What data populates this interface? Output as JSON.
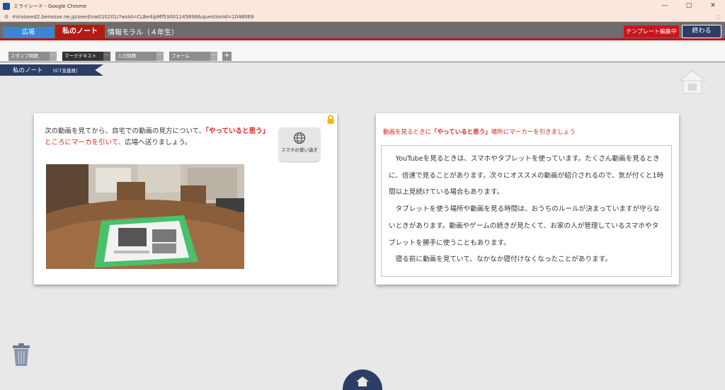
{
  "browser": {
    "window_title": "ミライシード - Google Chrome",
    "url": "miraiseed2.benesse.ne.jp/seed/vw010201/?wsId=CLBe4ipMf53001145698&questionId=1048069",
    "controls": [
      "—",
      "▢",
      "✕"
    ]
  },
  "header": {
    "tab_hiroba": "広場",
    "tab_mynote": "私のノート",
    "title": "情報モラル（４年生）",
    "template_button": "テンプレート編集中",
    "end_button": "終わる"
  },
  "toolbar": {
    "tabs": [
      {
        "label": "スタンプ問題",
        "more": "···"
      },
      {
        "label": "マークテキスト",
        "more": "···"
      },
      {
        "label": "入力問題",
        "more": "···"
      },
      {
        "label": "フォーム",
        "more": "···"
      }
    ],
    "add_label": "+"
  },
  "breadcrumb": {
    "title": "私のノート",
    "sub": "（ICT支援員）"
  },
  "left_card": {
    "instruction_1": "次の動画を見てから、自宅での動画の見方について、",
    "instruction_2": "「やっていると思う」",
    "instruction_3": "ところにマーカを引いて、",
    "instruction_4": "広場へ送りましょう。",
    "link_label": "スマホの使い過ぎ"
  },
  "right_card": {
    "heading_1": "動画を見るときに",
    "heading_2": "「やっていると思う」",
    "heading_3": "場所にマーカーを引きましょう",
    "paragraphs": [
      "YouTubeを見るときは、スマホやタブレットを使っています。たくさん動画を見るときに、倍速で見ることがあります。次々にオススメの動画が紹介されるので、気が付くと1時間以上見続けている場合もあります。",
      "タブレットを使う場所や動画を見る時間は、おうちのルールが決まっていますが守らないときがあります。動画やゲームの続きが見たくて、お家の人が管理しているスマホやタブレットを勝手に使うこともあります。",
      "寝る前に動画を見ていて、なかなか寝付けなくなったことがあります。"
    ]
  },
  "colors": {
    "accent_red": "#b31a14",
    "navy": "#2c3e66",
    "hiroba_blue": "#3a86d6",
    "mark_red": "#d9241c"
  }
}
